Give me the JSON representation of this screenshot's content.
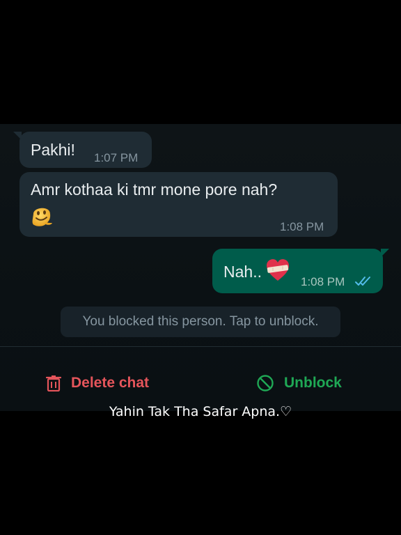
{
  "messages": [
    {
      "direction": "incoming",
      "text": "Pakhi!",
      "time": "1:07 PM"
    },
    {
      "direction": "incoming",
      "text": "Amr kothaa ki tmr mone pore nah?",
      "emoji": "melting-face-emoji",
      "time": "1:08 PM"
    },
    {
      "direction": "outgoing",
      "text": "Nah..",
      "emoji": "mending-heart-emoji",
      "time": "1:08 PM",
      "status": "read"
    }
  ],
  "system_note": "You blocked this person. Tap to unblock.",
  "actions": {
    "delete_label": "Delete chat",
    "delete_icon": "trash-icon",
    "unblock_label": "Unblock",
    "unblock_icon": "block-icon"
  },
  "caption": "Yahin Tak Tha Safar Apna.♡",
  "colors": {
    "incoming_bubble": "#1f2c34",
    "outgoing_bubble": "#005c4b",
    "delete": "#e5555b",
    "unblock": "#1fa855",
    "read_ticks": "#53bdeb"
  }
}
